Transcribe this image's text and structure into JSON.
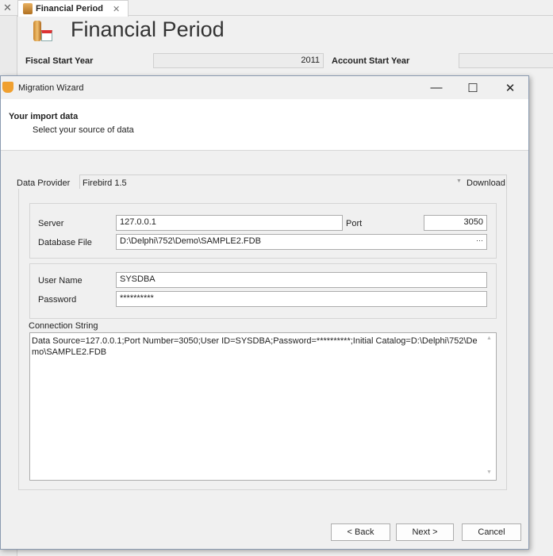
{
  "background": {
    "tab_label": "Financial Period",
    "page_title": "Financial Period",
    "fiscal_start_year_label": "Fiscal Start Year",
    "fiscal_start_year_value": "2011",
    "account_start_year_label": "Account Start Year"
  },
  "dialog": {
    "title": "Migration Wizard",
    "header_title": "Your import data",
    "header_subtitle": "Select your source of data",
    "data_provider_label": "Data Provider",
    "data_provider_value": "Firebird 1.5",
    "download_label": "Download",
    "server_label": "Server",
    "server_value": "127.0.0.1",
    "port_label": "Port",
    "port_value": "3050",
    "database_file_label": "Database File",
    "database_file_value": "D:\\Delphi\\752\\Demo\\SAMPLE2.FDB",
    "browse_label": "···",
    "user_name_label": "User Name",
    "user_name_value": "SYSDBA",
    "password_label": "Password",
    "password_value": "**********",
    "connection_string_label": "Connection String",
    "connection_string_value": "Data Source=127.0.0.1;Port Number=3050;User ID=SYSDBA;Password=**********;Initial Catalog=D:\\Delphi\\752\\Demo\\SAMPLE2.FDB",
    "back_label": "< Back",
    "next_label": "Next >",
    "cancel_label": "Cancel"
  }
}
